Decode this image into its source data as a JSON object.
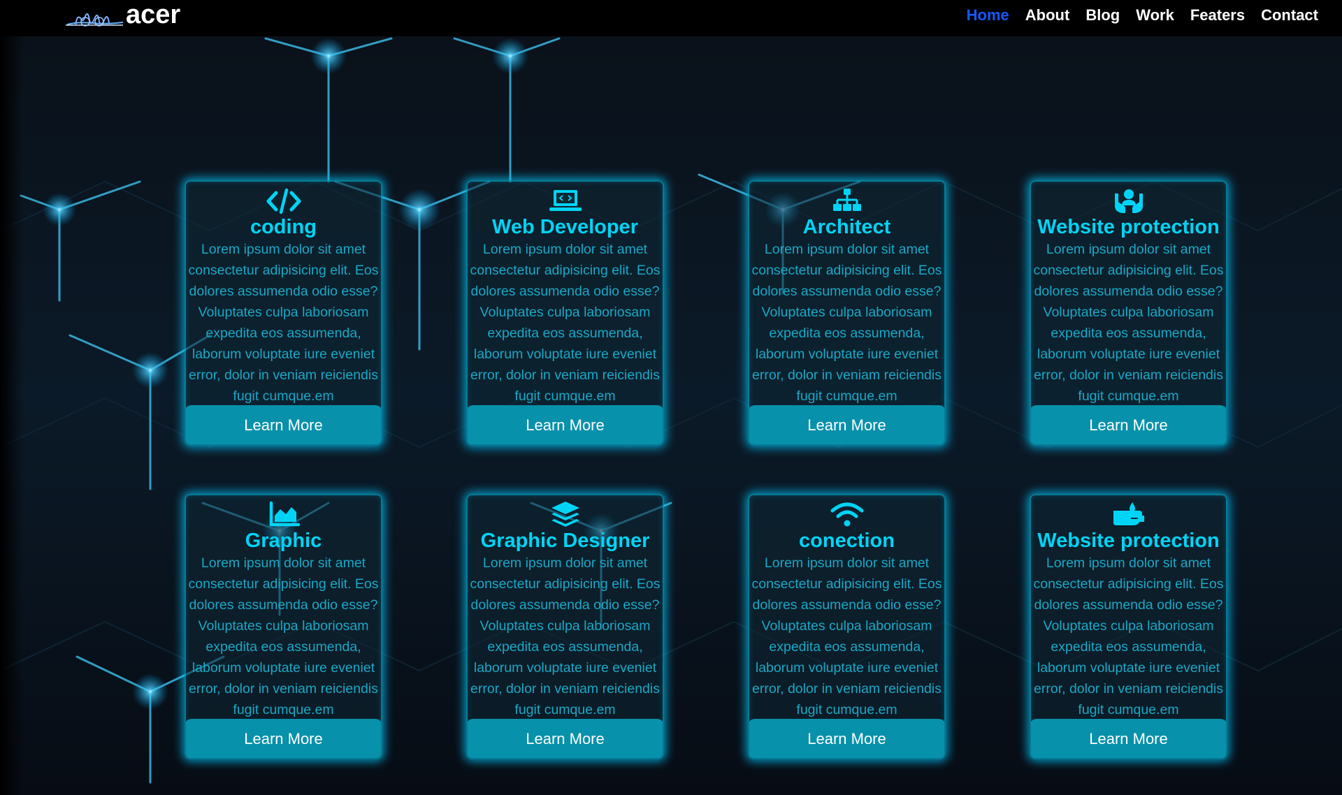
{
  "brand": {
    "name": "acer"
  },
  "nav": {
    "items": [
      {
        "label": "Home",
        "active": true
      },
      {
        "label": "About",
        "active": false
      },
      {
        "label": "Blog",
        "active": false
      },
      {
        "label": "Work",
        "active": false
      },
      {
        "label": "Featers",
        "active": false
      },
      {
        "label": "Contact",
        "active": false
      }
    ]
  },
  "colors": {
    "accent": "#00d4f6",
    "button": "#0891ab",
    "nav_active": "#1558ff",
    "body_text": "#1aa8c6"
  },
  "cards": [
    {
      "icon": "code-icon",
      "title": "coding",
      "text": "Lorem ipsum dolor sit amet consectetur adipisicing elit. Eos dolores assumenda odio esse? Voluptates culpa laboriosam expedita eos assumenda, laborum voluptate iure eveniet error, dolor in veniam reiciendis fugit cumque.em",
      "button": "Learn More"
    },
    {
      "icon": "laptop-code-icon",
      "title": "Web Developer",
      "text": "Lorem ipsum dolor sit amet consectetur adipisicing elit. Eos dolores assumenda odio esse? Voluptates culpa laboriosam expedita eos assumenda, laborum voluptate iure eveniet error, dolor in veniam reiciendis fugit cumque.em",
      "button": "Learn More"
    },
    {
      "icon": "sitemap-icon",
      "title": "Architect",
      "text": "Lorem ipsum dolor sit amet consectetur adipisicing elit. Eos dolores assumenda odio esse? Voluptates culpa laboriosam expedita eos assumenda, laborum voluptate iure eveniet error, dolor in veniam reiciendis fugit cumque.em",
      "button": "Learn More"
    },
    {
      "icon": "hands-holding-user-icon",
      "title": "Website protection",
      "text": "Lorem ipsum dolor sit amet consectetur adipisicing elit. Eos dolores assumenda odio esse? Voluptates culpa laboriosam expedita eos assumenda, laborum voluptate iure eveniet error, dolor in veniam reiciendis fugit cumque.em",
      "button": "Learn More"
    },
    {
      "icon": "area-chart-icon",
      "title": "Graphic",
      "text": "Lorem ipsum dolor sit amet consectetur adipisicing elit. Eos dolores assumenda odio esse? Voluptates culpa laboriosam expedita eos assumenda, laborum voluptate iure eveniet error, dolor in veniam reiciendis fugit cumque.em",
      "button": "Learn More"
    },
    {
      "icon": "layer-stack-icon",
      "title": "Graphic Designer",
      "text": "Lorem ipsum dolor sit amet consectetur adipisicing elit. Eos dolores assumenda odio esse? Voluptates culpa laboriosam expedita eos assumenda, laborum voluptate iure eveniet error, dolor in veniam reiciendis fugit cumque.em",
      "button": "Learn More"
    },
    {
      "icon": "wifi-icon",
      "title": "conection",
      "text": "Lorem ipsum dolor sit amet consectetur adipisicing elit. Eos dolores assumenda odio esse? Voluptates culpa laboriosam expedita eos assumenda, laborum voluptate iure eveniet error, dolor in veniam reiciendis fugit cumque.em",
      "button": "Learn More"
    },
    {
      "icon": "hand-holding-droplet-icon",
      "title": "Website protection",
      "text": "Lorem ipsum dolor sit amet consectetur adipisicing elit. Eos dolores assumenda odio esse? Voluptates culpa laboriosam expedita eos assumenda, laborum voluptate iure eveniet error, dolor in veniam reiciendis fugit cumque.em",
      "button": "Learn More"
    }
  ]
}
